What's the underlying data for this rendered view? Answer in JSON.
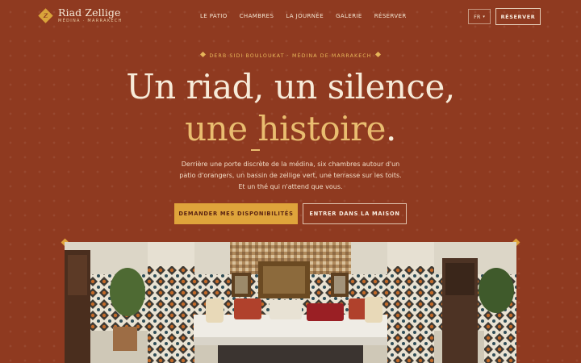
{
  "brand": {
    "name": "Riad Zellige",
    "subtitle": "MÉDINA · MARRAKECH",
    "mark": "Z"
  },
  "nav": {
    "items": [
      {
        "label": "LE PATIO"
      },
      {
        "label": "CHAMBRES"
      },
      {
        "label": "LA JOURNÉE"
      },
      {
        "label": "GALERIE"
      },
      {
        "label": "RÉSERVER"
      }
    ]
  },
  "header": {
    "language": "FR",
    "reserve_label": "RÉSERVER"
  },
  "hero": {
    "eyebrow": "DERB SIDI BOULOUKAT · MÉDINA DE MARRAKECH",
    "title_line1": "Un riad, un silence,",
    "title_line2": "une histoire",
    "title_dot": ".",
    "lead": [
      "Derrière une porte discrète de la médina, six chambres autour d'un",
      "patio d'orangers, un bassin de zellige vert, une terrasse sur les toits.",
      "Et un thé qui n'attend que vous."
    ],
    "cta_primary": "DEMANDER MES DISPONIBILITÉS",
    "cta_secondary": "ENTRER DANS LA MAISON"
  },
  "colors": {
    "background": "#8f3a20",
    "accent": "#dfa43b",
    "accent_text": "#e9bd70",
    "cream": "#f7ebd9"
  },
  "icons": {
    "logo": "diamond-monogram-icon",
    "language_caret": "chevron-down-icon",
    "ornament": "diamond-icon"
  },
  "photo": {
    "subject": "riad-patio-photo"
  }
}
